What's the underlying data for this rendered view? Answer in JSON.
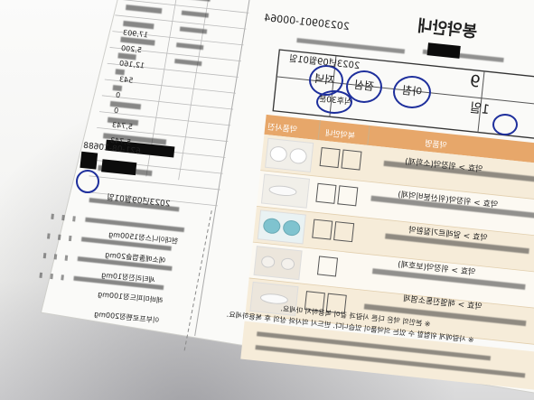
{
  "header": {
    "brand_text": "봉약안내",
    "doc_number": "20230901-00064",
    "issue_label": "조제일자",
    "date_text": "2023년09월01일"
  },
  "dosage_box": {
    "count_label": "1일",
    "days": "9",
    "times": [
      "아침",
      "점심",
      "저녁"
    ],
    "timing": [
      "식후30분"
    ]
  },
  "table_headers": [
    "약품명",
    "복약안내",
    "약품사진"
  ],
  "drugs": [
    {
      "name": "약효 > 위장약(소화제)"
    },
    {
      "name": "약효 > 위장약(위산분비억제)"
    },
    {
      "name": "약효 > 알레르기질환약"
    },
    {
      "name": "약효 > 위장약(보호제)"
    },
    {
      "name": "약효 > 해열진통소염제"
    }
  ],
  "footer_notes": [
    "※ 본인의 약은 다른 사람과 같이 복용하지 마세요.",
    "※ 사람에게 위험할 수 있는 의약품이 있습니다. 반드시 의사와 상의 후 복용하세요."
  ],
  "receipt": {
    "biz_number": "621-08-10688",
    "date_text": "2023년09월01일",
    "values": [
      "17,903",
      "5,200",
      "12,160",
      "543",
      "0",
      "0",
      "5,743",
      "5,743"
    ]
  },
  "bottom_list": [
    "현대이니스정1500mg",
    "에소메졸캡슐20mg",
    "세티리진정10mg",
    "레바미피드정100mg",
    "이부프로펜정200mg"
  ]
}
